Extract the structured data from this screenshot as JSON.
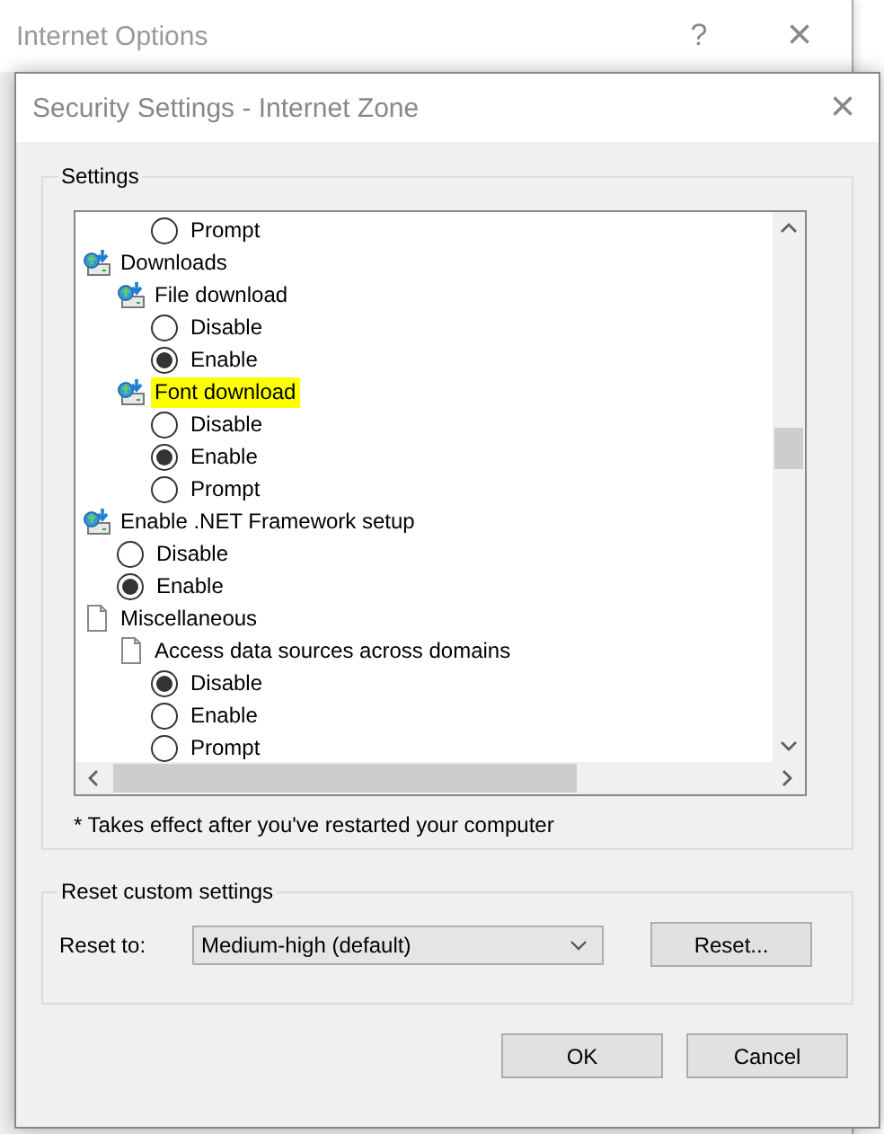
{
  "parent_window": {
    "title": "Internet Options",
    "help": "?",
    "close": "×"
  },
  "dialog": {
    "title": "Security Settings - Internet Zone",
    "close": "×"
  },
  "settings": {
    "label": "Settings",
    "tree": [
      {
        "kind": "group",
        "children": [
          {
            "kind": "group",
            "children": [
              {
                "kind": "radio",
                "label": "Prompt",
                "selected": false
              }
            ]
          }
        ]
      },
      {
        "kind": "network",
        "label": "Downloads",
        "selected": false,
        "children": [
          {
            "kind": "network",
            "label": "File download",
            "selected": false,
            "children": [
              {
                "kind": "radio",
                "label": "Disable",
                "selected": false
              },
              {
                "kind": "radio",
                "label": "Enable",
                "selected": true
              }
            ]
          },
          {
            "kind": "network",
            "label": "Font download",
            "selected": true,
            "children": [
              {
                "kind": "radio",
                "label": "Disable",
                "selected": false
              },
              {
                "kind": "radio",
                "label": "Enable",
                "selected": true
              },
              {
                "kind": "radio",
                "label": "Prompt",
                "selected": false
              }
            ]
          }
        ]
      },
      {
        "kind": "network",
        "label": "Enable .NET Framework setup",
        "selected": false,
        "children": [
          {
            "kind": "radio",
            "label": "Disable",
            "selected": false
          },
          {
            "kind": "radio",
            "label": "Enable",
            "selected": true
          }
        ]
      },
      {
        "kind": "document",
        "label": "Miscellaneous",
        "selected": false,
        "children": [
          {
            "kind": "document",
            "label": "Access data sources across domains",
            "selected": false,
            "children": [
              {
                "kind": "radio",
                "label": "Disable",
                "selected": true
              },
              {
                "kind": "radio",
                "label": "Enable",
                "selected": false
              },
              {
                "kind": "radio",
                "label": "Prompt",
                "selected": false
              }
            ]
          }
        ]
      }
    ],
    "note": "* Takes effect after you've restarted your computer"
  },
  "reset": {
    "label": "Reset custom settings",
    "reset_to_label": "Reset to:",
    "value": "Medium-high (default)",
    "button": "Reset..."
  },
  "buttons": [
    "OK",
    "Cancel"
  ]
}
